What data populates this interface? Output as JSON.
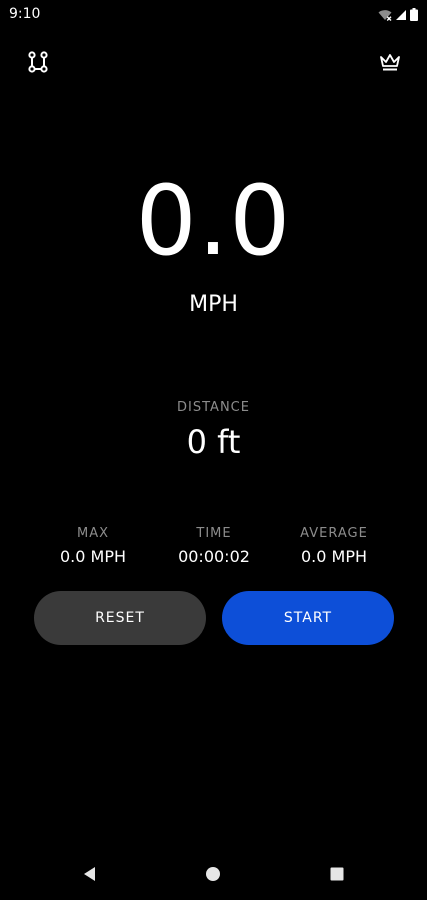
{
  "status_bar": {
    "time": "9:10",
    "icons": [
      "wifi-icon",
      "signal-icon",
      "battery-icon"
    ]
  },
  "toolbar": {
    "left_icon": "route-icon",
    "right_icon": "crown-icon"
  },
  "speed": {
    "value": "0.0",
    "unit": "MPH"
  },
  "distance": {
    "label": "DISTANCE",
    "value": "0 ft"
  },
  "stats": [
    {
      "label": "MAX",
      "value": "0.0 MPH"
    },
    {
      "label": "TIME",
      "value": "00:00:02"
    },
    {
      "label": "AVERAGE",
      "value": "0.0 MPH"
    }
  ],
  "buttons": {
    "reset_label": "RESET",
    "start_label": "START"
  },
  "colors": {
    "background": "#000000",
    "start_button": "#0d4fd8",
    "reset_button": "#3a3a3a",
    "label_gray": "#8c8c8c"
  },
  "nav_bar": {
    "icons": [
      "back-icon",
      "home-icon",
      "recents-icon"
    ]
  }
}
